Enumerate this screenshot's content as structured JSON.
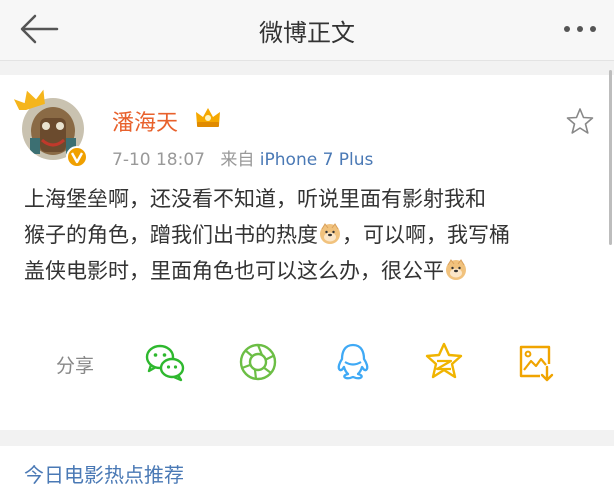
{
  "header": {
    "title": "微博正文",
    "back_icon": "back-arrow-icon",
    "more_icon": "more-dots-icon"
  },
  "post": {
    "author": "潘海天",
    "time": "7-10 18:07",
    "source_prefix": "来自",
    "source": "iPhone 7 Plus",
    "lines": [
      "上海堡垒啊，还没看不知道，听说里面有影射我和",
      "猴子的角色，蹭我们出书的热度",
      "，可以啊，我写桶",
      "盖侠电影时，里面角色也可以这么办，很公平"
    ],
    "emoji_icon": "doge-emoji-icon"
  },
  "share": {
    "label": "分享",
    "targets": [
      "wechat-icon",
      "moments-icon",
      "qq-icon",
      "qzone-icon",
      "save-image-icon"
    ]
  },
  "colors": {
    "author": "#e8612c",
    "link": "#4a79b5",
    "wechat": "#2eb82e",
    "moments": "#6cbe45",
    "qq": "#3fa9f5",
    "qzone": "#f0b400",
    "save": "#f0a400"
  },
  "section": {
    "title": "今日电影热点推荐"
  }
}
